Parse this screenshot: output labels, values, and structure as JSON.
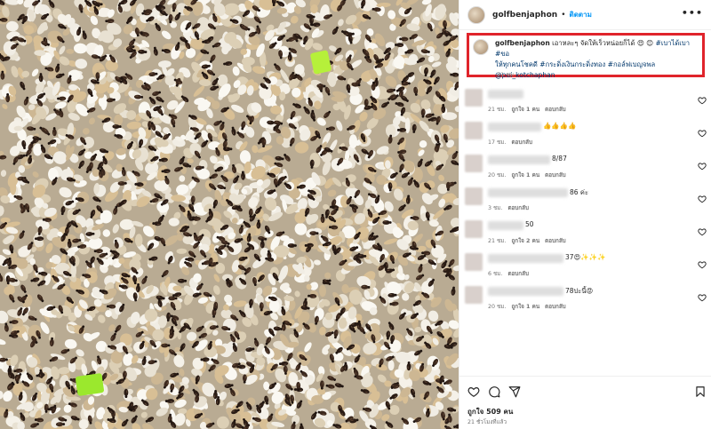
{
  "post": {
    "username": "golfbenjaphon",
    "follow_label": "ติดตาม",
    "more_icon": "more-horizontal-icon",
    "photo_description_icon": "post-photo"
  },
  "caption": {
    "username": "golfbenjaphon",
    "text": "เอาหละๆ จัดให้เร็วหน่อยก็ได้ 😍 😊",
    "tags_line1": "#เบาได้เบา #ขอ",
    "line2": "ให้ทุกคนโชคดี #กระดิ่งเงินกระดิ่งทอง #กอล์ฟเบญจพล",
    "mention": "@pui_kotchaphan",
    "time": "21 ชม.",
    "highlight_color": "#e0242b"
  },
  "comments": [
    {
      "text": "",
      "time": "21 ชม.",
      "likes": "ถูกใจ 1 คน",
      "reply": "ตอบกลับ"
    },
    {
      "text": "👍👍👍👍",
      "time": "17 ชม.",
      "likes": "",
      "reply": "ตอบกลับ"
    },
    {
      "text": "8/87",
      "time": "20 ชม.",
      "likes": "ถูกใจ 1 คน",
      "reply": "ตอบกลับ"
    },
    {
      "text": "86 ค่ะ",
      "time": "3 ชม.",
      "likes": "",
      "reply": "ตอบกลับ"
    },
    {
      "text": "50",
      "time": "21 ชม.",
      "likes": "ถูกใจ 2 คน",
      "reply": "ตอบกลับ"
    },
    {
      "text": "37😍✨✨✨",
      "time": "6 ชม.",
      "likes": "",
      "reply": "ตอบกลับ"
    },
    {
      "text": "78ปะนี้😡",
      "time": "20 ชม.",
      "likes": "ถูกใจ 1 คน",
      "reply": "ตอบกลับ"
    }
  ],
  "actions": {
    "likes": "ถูกใจ 509 คน",
    "posted": "21 ชั่วโมงที่แล้ว"
  }
}
